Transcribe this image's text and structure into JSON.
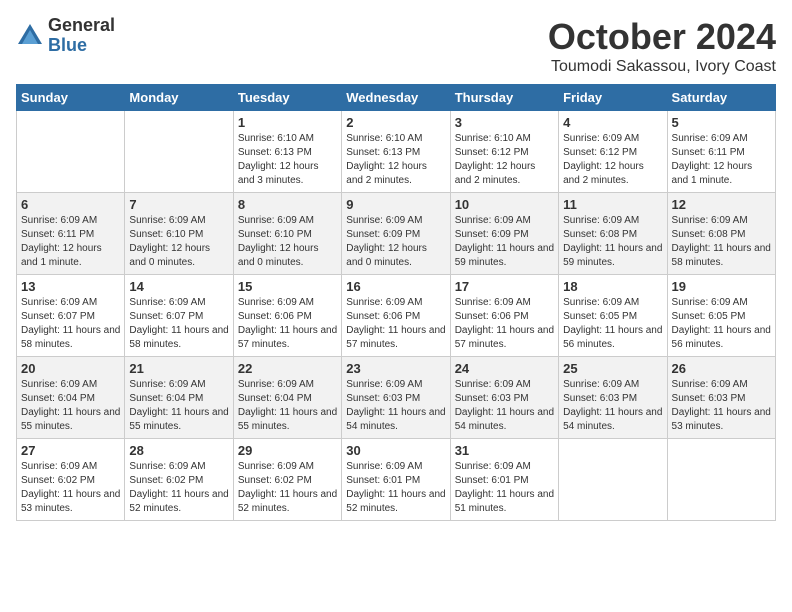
{
  "logo": {
    "general": "General",
    "blue": "Blue"
  },
  "title": {
    "month": "October 2024",
    "location": "Toumodi Sakassou, Ivory Coast"
  },
  "days_of_week": [
    "Sunday",
    "Monday",
    "Tuesday",
    "Wednesday",
    "Thursday",
    "Friday",
    "Saturday"
  ],
  "weeks": [
    [
      {
        "day": "",
        "info": ""
      },
      {
        "day": "",
        "info": ""
      },
      {
        "day": "1",
        "info": "Sunrise: 6:10 AM\nSunset: 6:13 PM\nDaylight: 12 hours and 3 minutes."
      },
      {
        "day": "2",
        "info": "Sunrise: 6:10 AM\nSunset: 6:13 PM\nDaylight: 12 hours and 2 minutes."
      },
      {
        "day": "3",
        "info": "Sunrise: 6:10 AM\nSunset: 6:12 PM\nDaylight: 12 hours and 2 minutes."
      },
      {
        "day": "4",
        "info": "Sunrise: 6:09 AM\nSunset: 6:12 PM\nDaylight: 12 hours and 2 minutes."
      },
      {
        "day": "5",
        "info": "Sunrise: 6:09 AM\nSunset: 6:11 PM\nDaylight: 12 hours and 1 minute."
      }
    ],
    [
      {
        "day": "6",
        "info": "Sunrise: 6:09 AM\nSunset: 6:11 PM\nDaylight: 12 hours and 1 minute."
      },
      {
        "day": "7",
        "info": "Sunrise: 6:09 AM\nSunset: 6:10 PM\nDaylight: 12 hours and 0 minutes."
      },
      {
        "day": "8",
        "info": "Sunrise: 6:09 AM\nSunset: 6:10 PM\nDaylight: 12 hours and 0 minutes."
      },
      {
        "day": "9",
        "info": "Sunrise: 6:09 AM\nSunset: 6:09 PM\nDaylight: 12 hours and 0 minutes."
      },
      {
        "day": "10",
        "info": "Sunrise: 6:09 AM\nSunset: 6:09 PM\nDaylight: 11 hours and 59 minutes."
      },
      {
        "day": "11",
        "info": "Sunrise: 6:09 AM\nSunset: 6:08 PM\nDaylight: 11 hours and 59 minutes."
      },
      {
        "day": "12",
        "info": "Sunrise: 6:09 AM\nSunset: 6:08 PM\nDaylight: 11 hours and 58 minutes."
      }
    ],
    [
      {
        "day": "13",
        "info": "Sunrise: 6:09 AM\nSunset: 6:07 PM\nDaylight: 11 hours and 58 minutes."
      },
      {
        "day": "14",
        "info": "Sunrise: 6:09 AM\nSunset: 6:07 PM\nDaylight: 11 hours and 58 minutes."
      },
      {
        "day": "15",
        "info": "Sunrise: 6:09 AM\nSunset: 6:06 PM\nDaylight: 11 hours and 57 minutes."
      },
      {
        "day": "16",
        "info": "Sunrise: 6:09 AM\nSunset: 6:06 PM\nDaylight: 11 hours and 57 minutes."
      },
      {
        "day": "17",
        "info": "Sunrise: 6:09 AM\nSunset: 6:06 PM\nDaylight: 11 hours and 57 minutes."
      },
      {
        "day": "18",
        "info": "Sunrise: 6:09 AM\nSunset: 6:05 PM\nDaylight: 11 hours and 56 minutes."
      },
      {
        "day": "19",
        "info": "Sunrise: 6:09 AM\nSunset: 6:05 PM\nDaylight: 11 hours and 56 minutes."
      }
    ],
    [
      {
        "day": "20",
        "info": "Sunrise: 6:09 AM\nSunset: 6:04 PM\nDaylight: 11 hours and 55 minutes."
      },
      {
        "day": "21",
        "info": "Sunrise: 6:09 AM\nSunset: 6:04 PM\nDaylight: 11 hours and 55 minutes."
      },
      {
        "day": "22",
        "info": "Sunrise: 6:09 AM\nSunset: 6:04 PM\nDaylight: 11 hours and 55 minutes."
      },
      {
        "day": "23",
        "info": "Sunrise: 6:09 AM\nSunset: 6:03 PM\nDaylight: 11 hours and 54 minutes."
      },
      {
        "day": "24",
        "info": "Sunrise: 6:09 AM\nSunset: 6:03 PM\nDaylight: 11 hours and 54 minutes."
      },
      {
        "day": "25",
        "info": "Sunrise: 6:09 AM\nSunset: 6:03 PM\nDaylight: 11 hours and 54 minutes."
      },
      {
        "day": "26",
        "info": "Sunrise: 6:09 AM\nSunset: 6:03 PM\nDaylight: 11 hours and 53 minutes."
      }
    ],
    [
      {
        "day": "27",
        "info": "Sunrise: 6:09 AM\nSunset: 6:02 PM\nDaylight: 11 hours and 53 minutes."
      },
      {
        "day": "28",
        "info": "Sunrise: 6:09 AM\nSunset: 6:02 PM\nDaylight: 11 hours and 52 minutes."
      },
      {
        "day": "29",
        "info": "Sunrise: 6:09 AM\nSunset: 6:02 PM\nDaylight: 11 hours and 52 minutes."
      },
      {
        "day": "30",
        "info": "Sunrise: 6:09 AM\nSunset: 6:01 PM\nDaylight: 11 hours and 52 minutes."
      },
      {
        "day": "31",
        "info": "Sunrise: 6:09 AM\nSunset: 6:01 PM\nDaylight: 11 hours and 51 minutes."
      },
      {
        "day": "",
        "info": ""
      },
      {
        "day": "",
        "info": ""
      }
    ]
  ]
}
